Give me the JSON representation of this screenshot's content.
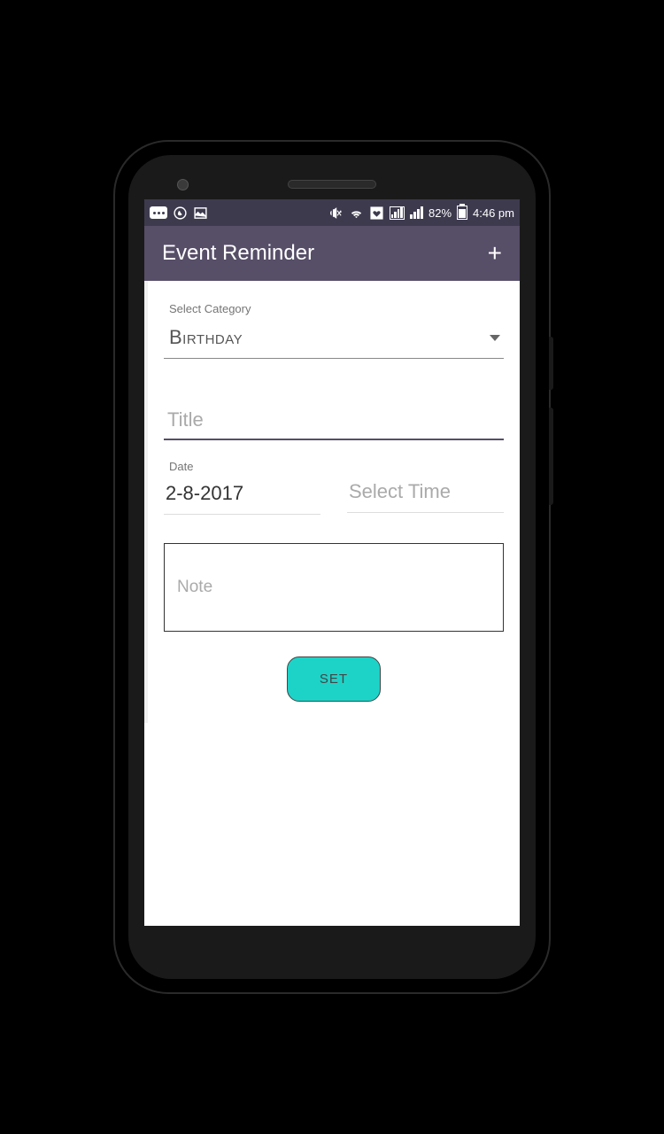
{
  "statusBar": {
    "batteryPercent": "82%",
    "time": "4:46 pm"
  },
  "appBar": {
    "title": "Event Reminder"
  },
  "form": {
    "categoryLabel": "Select Category",
    "categoryValue": "Birthday",
    "titlePlaceholder": "Title",
    "dateLabel": "Date",
    "dateValue": "2-8-2017",
    "timePlaceholder": "Select Time",
    "notePlaceholder": "Note",
    "setButton": "SET"
  }
}
